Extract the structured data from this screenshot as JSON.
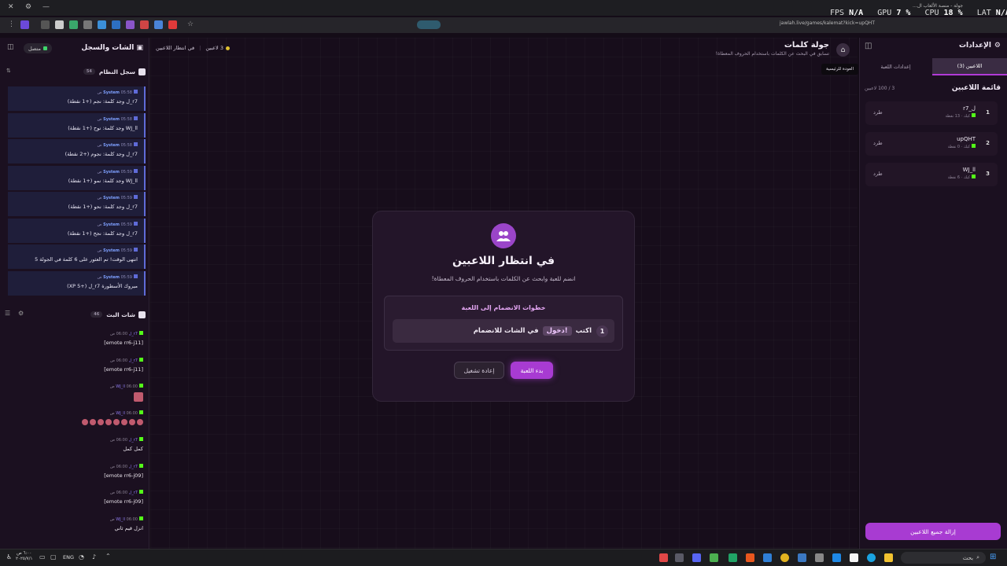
{
  "browser": {
    "url": "jawlah.live/games/kalemat?kick=upQHT",
    "tab_title": "جولة - منصة الألعاب ال...",
    "perf": {
      "fps_label": "FPS",
      "fps": "N/A",
      "gpu_label": "GPU",
      "gpu": "7 %",
      "cpu_label": "CPU",
      "cpu": "18 %",
      "lat_label": "LAT",
      "lat": "N/A"
    }
  },
  "left_panel": {
    "title": "الشات والسجل",
    "status": "متصل",
    "system_log": {
      "title": "سجل النظام",
      "count": "54",
      "entries": [
        {
          "sender": "System",
          "time": "05:58 ص",
          "text": "r7_ل وجد كلمة: نجم (+1 نقطة)"
        },
        {
          "sender": "System",
          "time": "05:58 ص",
          "text": "WJ_ll وجد كلمة: نوح (+1 نقطة)"
        },
        {
          "sender": "System",
          "time": "05:58 ص",
          "text": "r7_ل وجد كلمة: نجوم (+2 نقطة)"
        },
        {
          "sender": "System",
          "time": "05:59 ص",
          "text": "WJ_ll وجد كلمة: نمو (+1 نقطة)"
        },
        {
          "sender": "System",
          "time": "05:59 ص",
          "text": "r7_ل وجد كلمة: نحو (+1 نقطة)"
        },
        {
          "sender": "System",
          "time": "05:59 ص",
          "text": "r7_ل وجد كلمة: نجح (+1 نقطة)"
        },
        {
          "sender": "System",
          "time": "05:59 ص",
          "text": "انتهى الوقت! تم العثور على 6 كلمة في الجولة 5"
        },
        {
          "sender": "System",
          "time": "05:59 ص",
          "text": "مبروك الأسطورة r7_ل (+5 XP)"
        }
      ]
    },
    "live_chat": {
      "title": "شات البث",
      "count": "46",
      "messages": [
        {
          "user": "r7_ل",
          "time": "06:00 ص",
          "text": "[emote rr6-j11]"
        },
        {
          "user": "r7_ل",
          "time": "06:00 ص",
          "text": "[emote rr6-j11]"
        },
        {
          "user": "WJ_ll",
          "time": "06:00 ص",
          "text": ""
        },
        {
          "user": "WJ_ll",
          "time": "06:00 ص",
          "text": ""
        },
        {
          "user": "r7_ل",
          "time": "06:00 ص",
          "text": "كمل كمل"
        },
        {
          "user": "r7_ل",
          "time": "06:00 ص",
          "text": "[emote rr6-j09]"
        },
        {
          "user": "r7_ل",
          "time": "06:00 ص",
          "text": "[emote rr6-j09]"
        },
        {
          "user": "WJ_ll",
          "time": "06:00 ص",
          "text": "انزل قيم ثاني"
        }
      ]
    }
  },
  "header": {
    "title": "جولة كلمات",
    "subtitle": "تسابق في البحث عن الكلمات باستخدام الحروف المعطاة!",
    "tooltip": "العودة للرئيسية",
    "players_badge": "3 لاعبين",
    "status_badge": "في انتظار اللاعبين"
  },
  "card": {
    "title": "في انتظار اللاعبين",
    "subtitle": "انضم للعبة وابحث عن الكلمات باستخدام الحروف المعطاة!",
    "steps_title": "خطوات الانضمام إلى اللعبة",
    "step_number": "1",
    "step_prefix": "اكتب",
    "step_code": "!دخول",
    "step_suffix": "في الشات للانضمام",
    "start_button": "بدء اللعبة",
    "restart_button": "إعادة تشغيل"
  },
  "right_panel": {
    "title": "الإعدادات",
    "tabs": [
      "اللاعبين (3)",
      "إعدادات اللعبة"
    ],
    "list_title": "قائمة اللاعبين",
    "count": "3 / 100 لاعبين",
    "players": [
      {
        "rank": "1",
        "name": "r7_ل",
        "platform": "كيك",
        "points": "13 نقطة",
        "kick": "طرد"
      },
      {
        "rank": "2",
        "name": "upQHT",
        "platform": "كيك",
        "points": "0 نقطة",
        "kick": "طرد"
      },
      {
        "rank": "3",
        "name": "WJ_ll",
        "platform": "كيك",
        "points": "6 نقطة",
        "kick": "طرد"
      }
    ],
    "remove_all": "إزالة جميع اللاعبين"
  },
  "taskbar": {
    "search": "بحث",
    "lang": "ENG",
    "time": "٦:٠٠ ص",
    "date": "٢٠٢٥/٧/١"
  },
  "colors": {
    "accent": "#b13ad6",
    "kick_green": "#53fc18",
    "system_blue": "#5f6bd8"
  }
}
